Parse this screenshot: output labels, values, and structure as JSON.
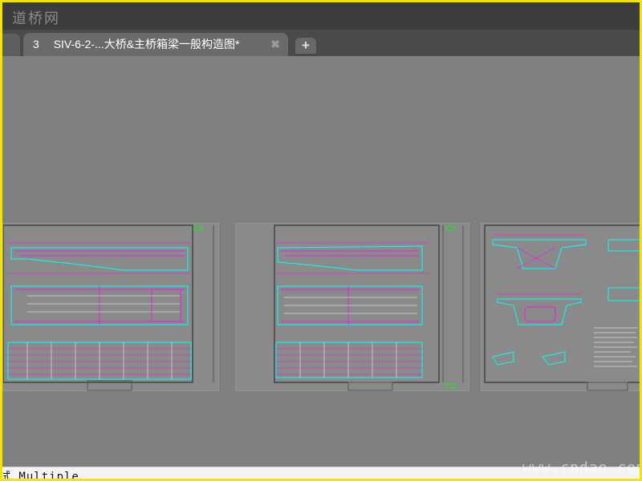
{
  "watermark_top": "道桥网",
  "tab": {
    "number": "3",
    "title": "SIV-6-2-...大桥&主桥箱梁一般构造图*",
    "close_glyph": "✖",
    "new_glyph": "+"
  },
  "command_line": "试   Multiple",
  "watermark_bottom": "www.cndao.com",
  "colors": {
    "background": "#808080",
    "drawing_magenta": "#ff00ff",
    "drawing_cyan": "#00ffff",
    "drawing_yellow": "#ffff00",
    "border_yellow": "#f2e600"
  }
}
